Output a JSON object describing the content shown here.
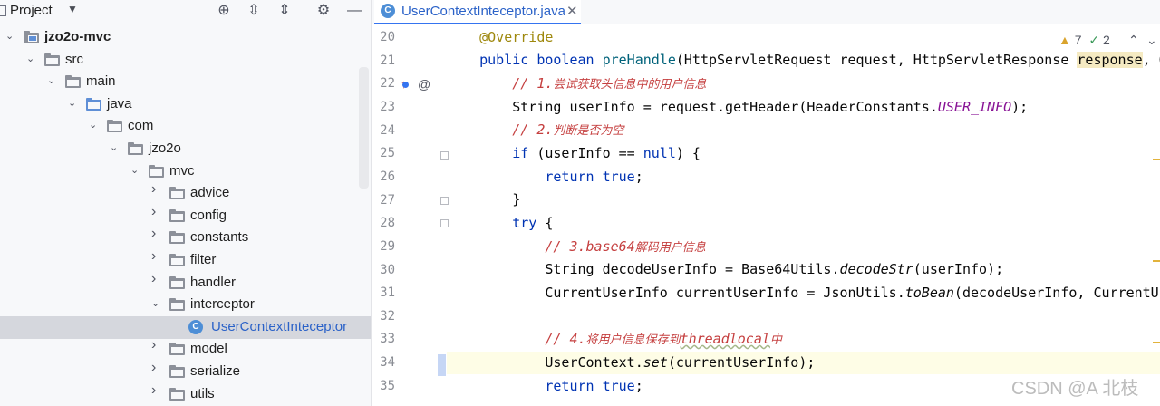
{
  "project_panel": {
    "title": "Project",
    "dropdown_icon": "triangle-down-icon",
    "toolbar_icons": [
      "crosshair-icon",
      "expand-all-icon",
      "collapse-all-icon",
      "gear-icon",
      "minimize-icon"
    ],
    "tree": [
      {
        "label": "jzo2o-mvc",
        "depth": 0,
        "expanded": true,
        "kind": "module",
        "bold": true
      },
      {
        "label": "src",
        "depth": 1,
        "expanded": true,
        "kind": "folder"
      },
      {
        "label": "main",
        "depth": 2,
        "expanded": true,
        "kind": "folder"
      },
      {
        "label": "java",
        "depth": 3,
        "expanded": true,
        "kind": "source-folder"
      },
      {
        "label": "com",
        "depth": 4,
        "expanded": true,
        "kind": "package"
      },
      {
        "label": "jzo2o",
        "depth": 5,
        "expanded": true,
        "kind": "package"
      },
      {
        "label": "mvc",
        "depth": 6,
        "expanded": true,
        "kind": "package"
      },
      {
        "label": "advice",
        "depth": 7,
        "expanded": false,
        "kind": "package"
      },
      {
        "label": "config",
        "depth": 7,
        "expanded": false,
        "kind": "package"
      },
      {
        "label": "constants",
        "depth": 7,
        "expanded": false,
        "kind": "package"
      },
      {
        "label": "filter",
        "depth": 7,
        "expanded": false,
        "kind": "package"
      },
      {
        "label": "handler",
        "depth": 7,
        "expanded": false,
        "kind": "package"
      },
      {
        "label": "interceptor",
        "depth": 7,
        "expanded": true,
        "kind": "package"
      },
      {
        "label": "UserContextInteceptor",
        "depth": 8,
        "expanded": null,
        "kind": "class",
        "selected": true
      },
      {
        "label": "model",
        "depth": 7,
        "expanded": false,
        "kind": "package"
      },
      {
        "label": "serialize",
        "depth": 7,
        "expanded": false,
        "kind": "package"
      },
      {
        "label": "utils",
        "depth": 7,
        "expanded": false,
        "kind": "package"
      }
    ]
  },
  "editor": {
    "tab": {
      "label": "UserContextInteceptor.java",
      "icon_letter": "C",
      "close": "✕"
    },
    "inspections": {
      "warnings": "7",
      "ok": "2",
      "warn_icon": "warning-triangle-icon",
      "ok_icon": "double-check-icon"
    },
    "line_numbers": [
      "20",
      "21",
      "22",
      "23",
      "24",
      "25",
      "26",
      "27",
      "28",
      "29",
      "30",
      "31",
      "32",
      "33",
      "34",
      "35"
    ],
    "current_line": "34",
    "code": {
      "l20_ann": "@Override",
      "l21_public": "public",
      "l21_boolean": "boolean",
      "l21_name": "preHandle",
      "l21_a": "(HttpServletRequest request, HttpServletResponse ",
      "l21_param": "response",
      "l21_b": ", Obj",
      "l22_prefix": "// 1.",
      "l22_cn": "尝试获取头信息中的用户信息",
      "l23_a": "String userInfo = request.getHeader(HeaderConstants.",
      "l23_const": "USER_INFO",
      "l23_b": ");",
      "l24_prefix": "// 2.",
      "l24_cn": "判断是否为空",
      "l25_if": "if",
      "l25_a": " (userInfo == ",
      "l25_null": "null",
      "l25_b": ") {",
      "l26_return": "return",
      "l26_true": "true",
      "l26_b": ";",
      "l27": "}",
      "l28_try": "try",
      "l28_b": " {",
      "l29_prefix": "// 3.base64",
      "l29_cn": "解码用户信息",
      "l30_a": "String decodeUserInfo = Base64Utils.",
      "l30_fn": "decodeStr",
      "l30_b": "(userInfo);",
      "l31_a": "CurrentUserInfo currentUserInfo = JsonUtils.",
      "l31_fn": "toBean",
      "l31_b": "(decodeUserInfo, CurrentUser",
      "l33_prefix": "// 4.",
      "l33_cn1": "将用户信息保存到",
      "l33_en": "threadlocal",
      "l33_cn2": "中",
      "l34_a": "UserContext.",
      "l34_fn": "set",
      "l34_b": "(currentUserInfo);",
      "l35_return": "return",
      "l35_true": "true",
      "l35_b": ";"
    }
  },
  "watermark": "CSDN @A 北枝"
}
